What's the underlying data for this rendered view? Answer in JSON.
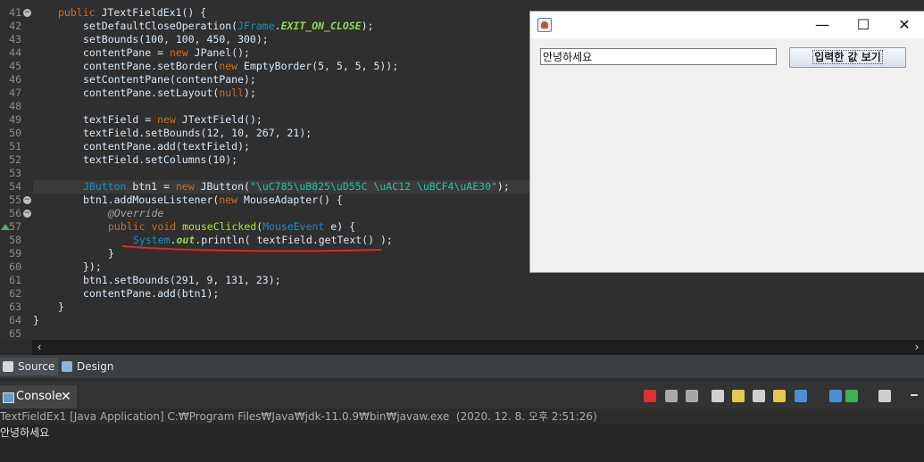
{
  "editor": {
    "line_numbers": [
      "41",
      "42",
      "43",
      "44",
      "45",
      "46",
      "47",
      "48",
      "49",
      "50",
      "51",
      "52",
      "53",
      "54",
      "55",
      "56",
      "57",
      "58",
      "59",
      "60",
      "61",
      "62",
      "63",
      "64",
      "65"
    ],
    "code": {
      "l41": {
        "kw": "public",
        "name": " JTextFieldEx1() {"
      },
      "l42": {
        "a": "setDefaultCloseOperation(",
        "t": "JFrame",
        "b": ".",
        "c": "EXIT_ON_CLOSE",
        "d": ");"
      },
      "l43": "setBounds(100, 100, 450, 300);",
      "l44": {
        "a": "contentPane = ",
        "kw": "new",
        "t": " JPanel",
        "b": "();"
      },
      "l45": {
        "a": "contentPane.setBorder(",
        "kw": "new",
        "t": " EmptyBorder",
        "b": "(5, 5, 5, 5));"
      },
      "l46": "setContentPane(contentPane);",
      "l47": {
        "a": "contentPane.setLayout(",
        "kw": "null",
        "b": ");"
      },
      "l49": {
        "a": "textField = ",
        "kw": "new",
        "t": " JTextField",
        "b": "();"
      },
      "l50": "textField.setBounds(12, 10, 267, 21);",
      "l51": "contentPane.add(textField);",
      "l52": "textField.setColumns(10);",
      "l54": {
        "t": "JButton",
        "a": " btn1 = ",
        "kw": "new",
        "t2": " JButton",
        "b": "(",
        "s": "\"\\uC785\\uB825\\uD55C \\uAC12 \\uBCF4\\uAE30\"",
        "c": ");"
      },
      "l55": {
        "a": "btn1.addMouseListener(",
        "kw": "new",
        "t": " MouseAdapter",
        "b": "() {"
      },
      "l56": "@Override",
      "l57": {
        "kw": "public",
        "kw2": " void",
        "fn": " mouseClicked",
        "b": "(",
        "t": "MouseEvent",
        "c": " e) {"
      },
      "l58": {
        "t": "System",
        "b": ".",
        "o": "out",
        "c": ".println( textField.getText() );"
      },
      "l59": "}",
      "l60": "});",
      "l61": "btn1.setBounds(291, 9, 131, 23);",
      "l62": "contentPane.add(btn1);",
      "l63": "}",
      "l64": "}"
    },
    "underline_color": "#e8202a",
    "fold_markers": [
      "41",
      "55",
      "56"
    ],
    "override_marker_line": "57"
  },
  "editor_tabs": [
    {
      "label": "Source",
      "icon": "source-icon",
      "active": true
    },
    {
      "label": "Design",
      "icon": "design-icon",
      "active": false
    }
  ],
  "console": {
    "tab_label": "Console",
    "status_line": "TextFieldEx1 [Java Application] C:₩Program Files₩Java₩jdk-11.0.9₩bin₩javaw.exe  (2020. 12. 8. 오후 2:51:26)",
    "output": "안녕하세요",
    "toolbar_icons": [
      "terminate-icon",
      "remove-launch-icon",
      "remove-all-icon",
      "show-console-icon",
      "pin-icon",
      "word-wrap-icon",
      "scroll-lock-icon",
      "clear-console-icon",
      "display-selected-console-icon",
      "open-console-icon",
      "new-console-icon",
      "minimize-icon"
    ]
  },
  "swing_window": {
    "text_field_value": "안녕하세요",
    "button_label": "입력한 값 보기",
    "minimize_glyph": "—",
    "maximize_glyph": "☐",
    "close_glyph": "✕"
  },
  "colors": {
    "editor_bg": "#2f2f2f",
    "keyword": "#cc6c1d",
    "type": "#1290c3",
    "string": "#17c6a3",
    "window_bg": "#f0f0f0"
  }
}
